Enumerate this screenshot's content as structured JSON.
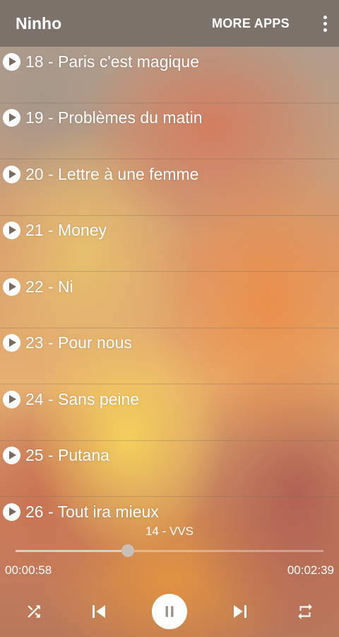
{
  "header": {
    "title": "Ninho",
    "more_apps_label": "MORE APPS"
  },
  "tracks": [
    {
      "label": "18 - Paris c'est magique"
    },
    {
      "label": "19 - Problèmes du matin"
    },
    {
      "label": "20 - Lettre à une femme"
    },
    {
      "label": "21 - Money"
    },
    {
      "label": "22 - Ni"
    },
    {
      "label": "23 - Pour nous"
    },
    {
      "label": "24 - Sans peine"
    },
    {
      "label": "25 - Putana"
    },
    {
      "label": "26 - Tout ira mieux"
    }
  ],
  "player": {
    "now_playing": "14 - VVS",
    "elapsed": "00:00:58",
    "total": "00:02:39",
    "progress": 0.365
  },
  "icons": {
    "track_play": "play-circle-icon",
    "overflow": "more-vert-icon",
    "shuffle": "shuffle-icon",
    "previous": "skip-previous-icon",
    "pause": "pause-icon",
    "next": "skip-next-icon",
    "repeat": "repeat-icon"
  },
  "colors": {
    "header_bg": "#7d7269",
    "text": "#ffffff"
  }
}
